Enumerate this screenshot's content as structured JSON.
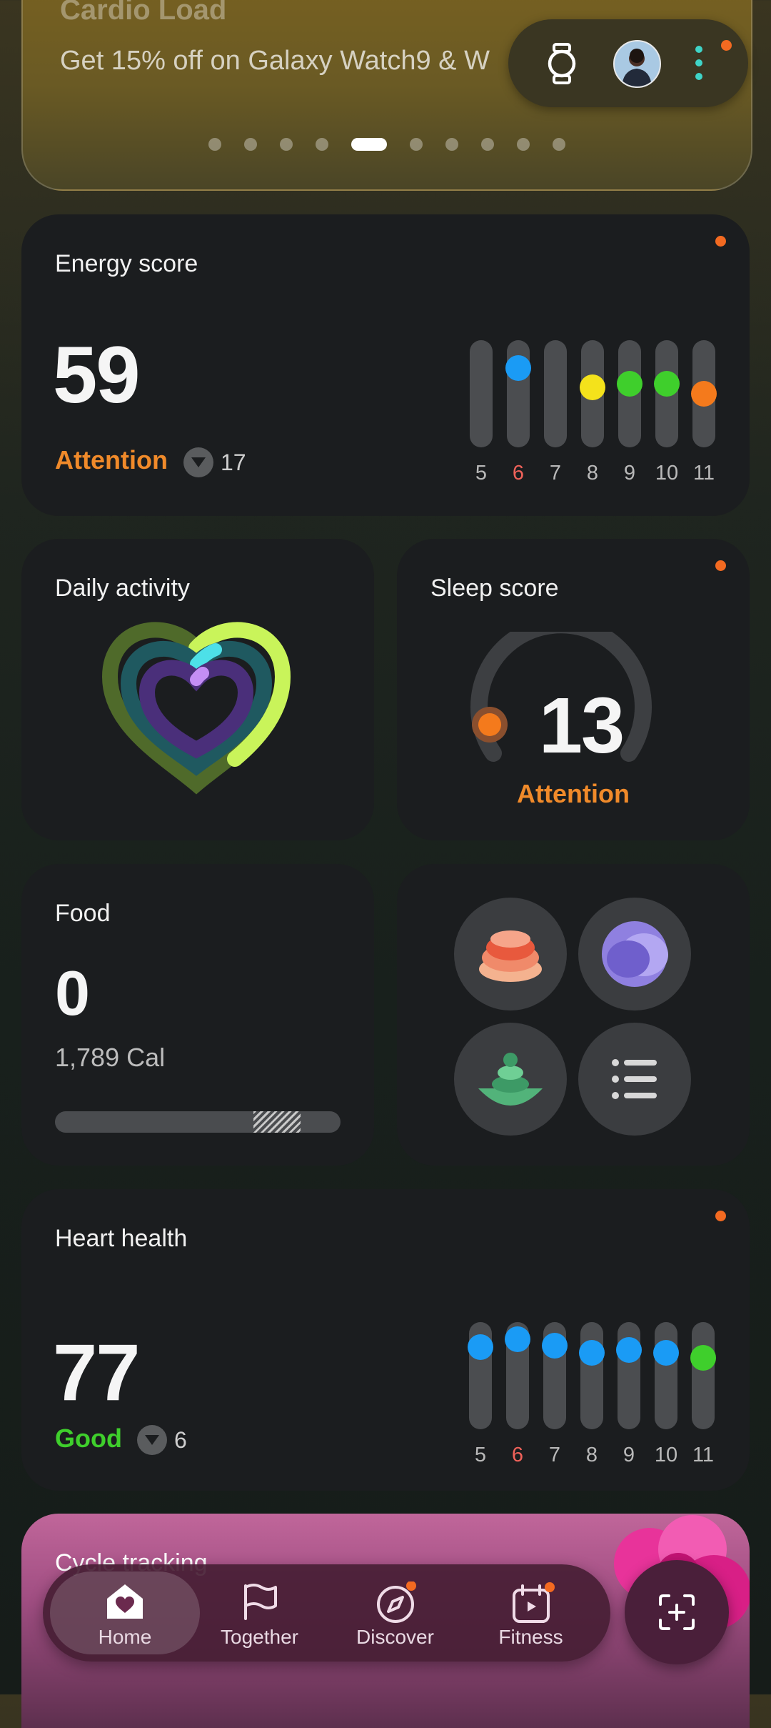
{
  "promo": {
    "title": "Cardio Load",
    "subtitle": "Get 15% off on Galaxy Watch9 & W",
    "pages": 10,
    "active_page": 5
  },
  "header": {
    "watch_icon": "watch-icon",
    "avatar": "profile-avatar",
    "more_icon": "more-vert-icon"
  },
  "energy": {
    "title": "Energy score",
    "value": "59",
    "status": "Attention",
    "delta": "17",
    "days": [
      "5",
      "6",
      "7",
      "8",
      "9",
      "10",
      "11"
    ],
    "levels": [
      null,
      0.82,
      null,
      0.58,
      0.62,
      0.62,
      0.5
    ],
    "dot_colors": [
      null,
      "#1a9bf5",
      null,
      "#f4e21b",
      "#3fcf2c",
      "#3fcf2c",
      "#f47a1c"
    ]
  },
  "activity": {
    "title": "Daily activity"
  },
  "sleep": {
    "title": "Sleep score",
    "value": "13",
    "status": "Attention"
  },
  "food": {
    "title": "Food",
    "value": "0",
    "calories": "1,789 Cal"
  },
  "quick_tiles": [
    "body-composition-icon",
    "stress-icon",
    "mindfulness-icon",
    "list-icon"
  ],
  "heart": {
    "title": "Heart health",
    "value": "77",
    "status": "Good",
    "delta": "6",
    "days": [
      "5",
      "6",
      "7",
      "8",
      "9",
      "10",
      "11"
    ],
    "levels": [
      0.85,
      0.95,
      0.87,
      0.78,
      0.82,
      0.78,
      0.72
    ],
    "dot_colors": [
      "#1a9bf5",
      "#1a9bf5",
      "#1a9bf5",
      "#1a9bf5",
      "#1a9bf5",
      "#1a9bf5",
      "#3fcf2c"
    ]
  },
  "cycle": {
    "title": "Cycle tracking"
  },
  "nav": {
    "home": "Home",
    "together": "Together",
    "discover": "Discover",
    "fitness": "Fitness"
  },
  "colors": {
    "attention": "#f08a2a",
    "good": "#3fcf2c",
    "highlight_day": "#f0625a"
  }
}
